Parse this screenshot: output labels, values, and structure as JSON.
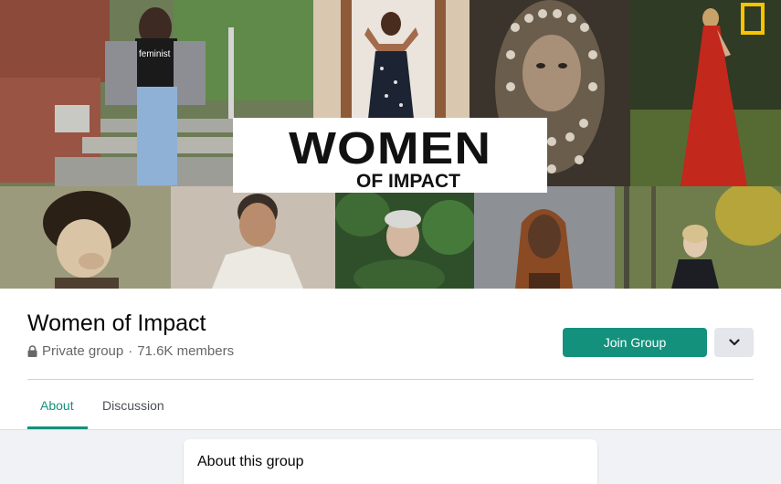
{
  "cover": {
    "title_line1": "WOMEN",
    "title_line2": "OF IMPACT",
    "shirt_text": "feminist"
  },
  "group": {
    "name": "Women of Impact",
    "privacy": "Private group",
    "separator": "·",
    "members": "71.6K members"
  },
  "actions": {
    "join_label": "Join Group",
    "more_icon": "chevron-down-icon"
  },
  "tabs": [
    {
      "label": "About",
      "active": true
    },
    {
      "label": "Discussion",
      "active": false
    }
  ],
  "about_card": {
    "title": "About this group"
  },
  "colors": {
    "accent": "#14917d",
    "logo_yellow": "#f7c400",
    "background": "#f0f2f5"
  }
}
